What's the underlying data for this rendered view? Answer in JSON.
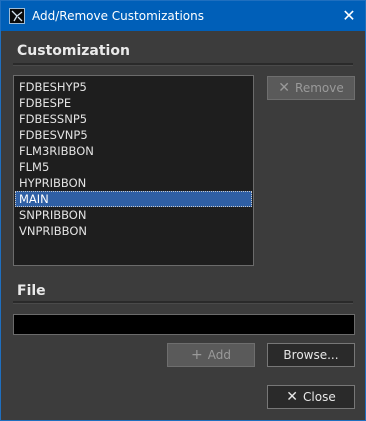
{
  "window": {
    "title": "Add/Remove Customizations",
    "close_glyph": "✕"
  },
  "customization": {
    "heading": "Customization",
    "items": [
      "FDBESHYP5",
      "FDBESPE",
      "FDBESSNP5",
      "FDBESVNP5",
      "FLM3RIBBON",
      "FLM5",
      "HYPRIBBON",
      "MAIN",
      "SNPRIBBON",
      "VNPRIBBON"
    ],
    "selected_index": 7,
    "remove_label": "Remove",
    "remove_icon": "close-icon"
  },
  "file": {
    "heading": "File",
    "path_value": "",
    "add_label": "Add",
    "add_icon": "plus-icon",
    "browse_label": "Browse..."
  },
  "footer": {
    "close_label": "Close",
    "close_icon": "close-icon"
  }
}
